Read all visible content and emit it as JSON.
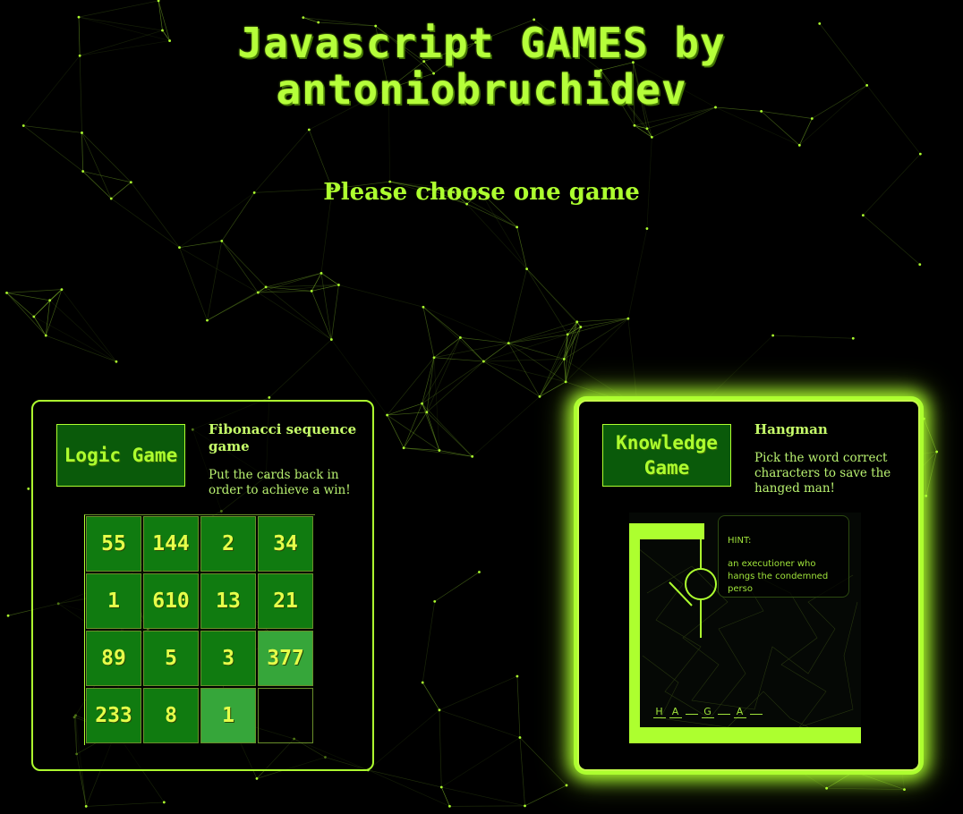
{
  "header": {
    "title_line1": "Javascript GAMES by",
    "title_line2": "antoniobruchidev",
    "subtitle": "Please choose one game"
  },
  "colors": {
    "accent": "#adff2f",
    "tile_dark": "#107b10",
    "tile_light": "#36a63a",
    "badge_bg": "#0a5a0a",
    "tile_text": "#e6ff4a",
    "background": "#000000"
  },
  "games": [
    {
      "badge": "Logic Game",
      "title": "Fibonacci sequence game",
      "description": "Put the cards back in order to achieve a win!",
      "board": [
        {
          "value": "55",
          "style": "dark"
        },
        {
          "value": "144",
          "style": "dark"
        },
        {
          "value": "2",
          "style": "dark"
        },
        {
          "value": "34",
          "style": "dark"
        },
        {
          "value": "1",
          "style": "dark"
        },
        {
          "value": "610",
          "style": "dark"
        },
        {
          "value": "13",
          "style": "dark"
        },
        {
          "value": "21",
          "style": "dark"
        },
        {
          "value": "89",
          "style": "dark"
        },
        {
          "value": "5",
          "style": "dark"
        },
        {
          "value": "3",
          "style": "dark"
        },
        {
          "value": "377",
          "style": "light"
        },
        {
          "value": "233",
          "style": "dark"
        },
        {
          "value": "8",
          "style": "dark"
        },
        {
          "value": "1",
          "style": "light"
        },
        {
          "value": "",
          "style": "empty"
        }
      ]
    },
    {
      "badge_line1": "Knowledge",
      "badge_line2": "Game",
      "title": "Hangman",
      "description": "Pick the word correct characters to save the hanged man!",
      "hint_label": "HINT:",
      "hint_text": "an executioner who hangs the condemned perso",
      "word_letters": [
        "H",
        "A",
        "",
        "G",
        "",
        "A",
        ""
      ]
    }
  ]
}
